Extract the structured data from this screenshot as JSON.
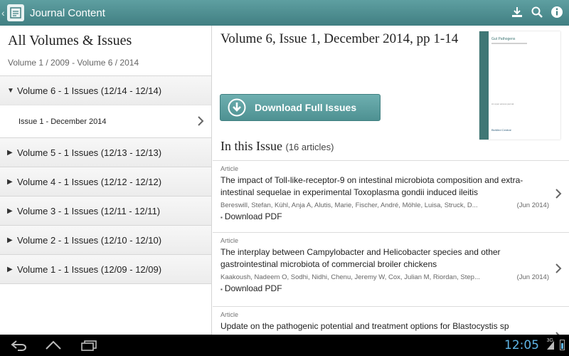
{
  "actionbar": {
    "title": "Journal Content",
    "icons": [
      "back-icon",
      "app-logo-icon",
      "download-icon",
      "search-icon",
      "info-icon"
    ]
  },
  "sidebar": {
    "title": "All Volumes & Issues",
    "subtitle": "Volume 1 / 2009 - Volume 6 / 2014",
    "volumes": [
      {
        "label": "Volume 6 - 1 Issues (12/14  -  12/14)",
        "expanded": true,
        "issues": [
          {
            "label": "Issue 1 - December 2014"
          }
        ]
      },
      {
        "label": "Volume 5 - 1 Issues (12/13  -  12/13)",
        "expanded": false
      },
      {
        "label": "Volume 4 - 1 Issues (12/12  -  12/12)",
        "expanded": false
      },
      {
        "label": "Volume 3 - 1 Issues (12/11  -  12/11)",
        "expanded": false
      },
      {
        "label": "Volume 2 - 1 Issues (12/10  -  12/10)",
        "expanded": false
      },
      {
        "label": "Volume 1 - 1 Issues (12/09  -  12/09)",
        "expanded": false
      }
    ]
  },
  "main": {
    "issue_title": "Volume 6, Issue 1, December 2014, pp 1-14",
    "download_button": "Download Full Issues",
    "cover": {
      "journal_name": "Gut Pathogens",
      "tagline": "An open access journal",
      "publisher": "BioMed Central"
    },
    "in_this_issue": "In this Issue",
    "article_count": "(16 articles)",
    "articles": [
      {
        "type": "Article",
        "title": "The impact of Toll-like-receptor-9 on intestinal microbiota composition and extra-intestinal sequelae in experimental Toxoplasma gondii induced ileitis",
        "authors": "Bereswill, Stefan, Kühl, Anja A, Alutis, Marie, Fischer, André, Möhle, Luisa, Struck, D...",
        "date": "(Jun 2014)",
        "pdf": "Download PDF"
      },
      {
        "type": "Article",
        "title": "The interplay between Campylobacter and Helicobacter species and other gastrointestinal microbiota of commercial broiler chickens",
        "authors": "Kaakoush, Nadeem O, Sodhi, Nidhi, Chenu, Jeremy W, Cox, Julian M, Riordan, Step...",
        "date": "(Jun 2014)",
        "pdf": "Download PDF"
      },
      {
        "type": "Article",
        "title": "Update on the pathogenic potential and treatment options for Blastocystis sp",
        "authors": "",
        "date": "",
        "pdf": ""
      }
    ]
  },
  "statusbar": {
    "time": "12:05",
    "network": "3G",
    "accent": "#5fb5e6"
  }
}
